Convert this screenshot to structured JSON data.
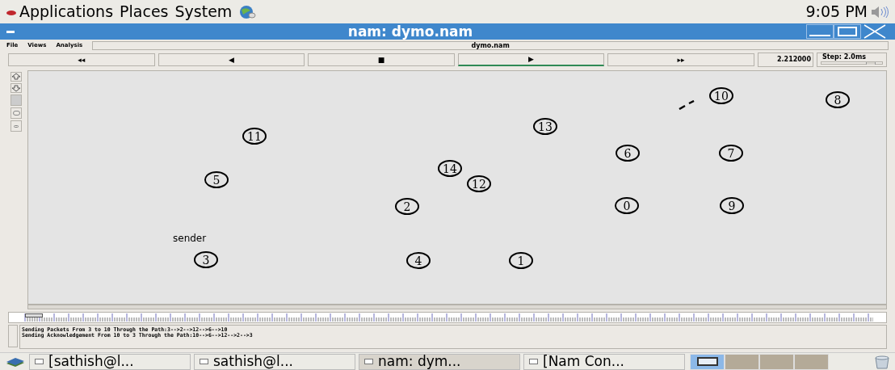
{
  "top_panel": {
    "menus": [
      "Applications",
      "Places",
      "System"
    ],
    "clock": "9:05 PM"
  },
  "window": {
    "title": "nam: dymo.nam"
  },
  "menu_bar": {
    "items": [
      "File",
      "Views",
      "Analysis"
    ],
    "file_name": "dymo.nam"
  },
  "playback": {
    "buttons": [
      {
        "label": "◂◂",
        "selected": false
      },
      {
        "label": "◀",
        "selected": false
      },
      {
        "label": "■",
        "selected": false
      },
      {
        "label": "▶",
        "selected": true
      },
      {
        "label": "▸▸",
        "selected": false
      }
    ],
    "time": "2.212000",
    "step": "Step: 2.0ms",
    "step_slider": {
      "level": 0.82
    }
  },
  "nodes": [
    {
      "label": "10"
    },
    {
      "label": "8"
    },
    {
      "label": "13"
    },
    {
      "label": "11"
    },
    {
      "label": "6"
    },
    {
      "label": "7"
    },
    {
      "label": "14"
    },
    {
      "label": "12"
    },
    {
      "label": "5"
    },
    {
      "label": "2"
    },
    {
      "label": "0"
    },
    {
      "label": "9"
    },
    {
      "label": "3",
      "caption": "sender"
    },
    {
      "label": "4"
    },
    {
      "label": "1"
    }
  ],
  "log": [
    "Sending Packets From 3 to 10 Through the Path:3-->2-->12-->6-->10",
    "Sending Acknowledgement From 10 to 3 Through the Path:10-->6-->12-->2-->3"
  ],
  "taskbar": {
    "items": [
      {
        "label": "[sathish@l...",
        "selected": false
      },
      {
        "label": "sathish@l...",
        "selected": false
      },
      {
        "label": "nam: dym...",
        "selected": true
      },
      {
        "label": "[Nam Con...",
        "selected": false
      }
    ],
    "workspaces": [
      {
        "selected": true
      },
      {
        "selected": false
      },
      {
        "selected": false
      },
      {
        "selected": false
      }
    ]
  }
}
